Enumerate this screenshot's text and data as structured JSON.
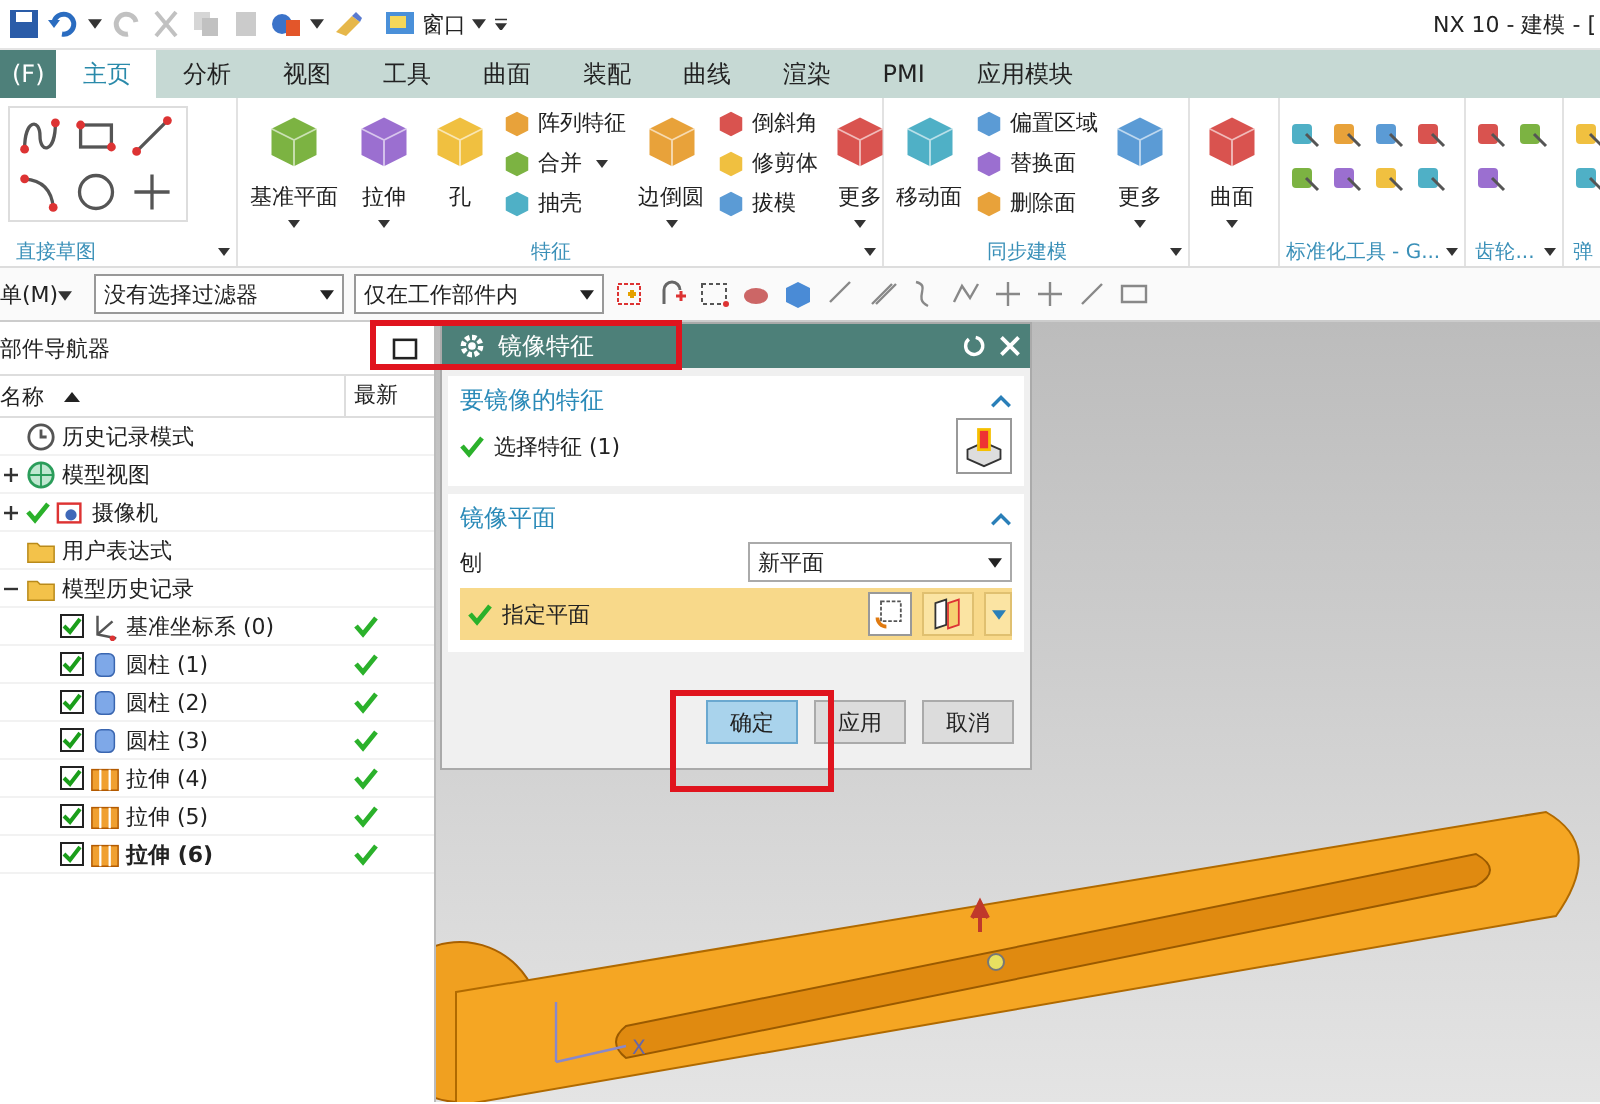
{
  "quick_access": {
    "window_menu": "窗口"
  },
  "window": {
    "title": "NX 10 - 建模 - ["
  },
  "tabs": [
    {
      "label": "(F)",
      "selected": false,
      "kind": "file"
    },
    {
      "label": "主页",
      "selected": true,
      "kind": "tab"
    },
    {
      "label": "分析",
      "selected": false,
      "kind": "tab"
    },
    {
      "label": "视图",
      "selected": false,
      "kind": "tab"
    },
    {
      "label": "工具",
      "selected": false,
      "kind": "tab"
    },
    {
      "label": "曲面",
      "selected": false,
      "kind": "tab"
    },
    {
      "label": "装配",
      "selected": false,
      "kind": "tab"
    },
    {
      "label": "曲线",
      "selected": false,
      "kind": "tab"
    },
    {
      "label": "渲染",
      "selected": false,
      "kind": "tab"
    },
    {
      "label": "PMI",
      "selected": false,
      "kind": "tab"
    },
    {
      "label": "应用模块",
      "selected": false,
      "kind": "tab"
    }
  ],
  "ribbon": [
    {
      "title": "直接草图",
      "kind": "sketch"
    },
    {
      "title": "特征",
      "kind": "buttons",
      "items": [
        {
          "kind": "large",
          "label": "基准平面",
          "menu": true
        },
        {
          "kind": "large",
          "label": "拉伸",
          "menu": true
        },
        {
          "kind": "large",
          "label": "孔",
          "menu": false
        },
        {
          "kind": "stack",
          "items": [
            {
              "label": "阵列特征",
              "menu": false
            },
            {
              "label": "合并",
              "menu": true
            },
            {
              "label": "抽壳",
              "menu": false
            }
          ]
        },
        {
          "kind": "large",
          "label": "边倒圆",
          "menu": true
        },
        {
          "kind": "stack",
          "items": [
            {
              "label": "倒斜角",
              "menu": false
            },
            {
              "label": "修剪体",
              "menu": false
            },
            {
              "label": "拔模",
              "menu": false
            }
          ]
        },
        {
          "kind": "large",
          "label": "更多",
          "menu": true
        }
      ]
    },
    {
      "title": "同步建模",
      "kind": "buttons",
      "items": [
        {
          "kind": "large",
          "label": "移动面",
          "menu": false
        },
        {
          "kind": "stack",
          "items": [
            {
              "label": "偏置区域",
              "menu": false
            },
            {
              "label": "替换面",
              "menu": false
            },
            {
              "label": "删除面",
              "menu": false
            }
          ]
        },
        {
          "kind": "large",
          "label": "更多",
          "menu": true
        }
      ]
    },
    {
      "kind": "buttons",
      "items": [
        {
          "kind": "large",
          "label": "曲面",
          "menu": true
        }
      ]
    },
    {
      "title": "标准化工具 - G...",
      "kind": "grid"
    },
    {
      "title": "齿轮...",
      "kind": "grid"
    },
    {
      "title": "弹",
      "kind": "grid"
    }
  ],
  "selection_bar": {
    "menu_label": "单(M)",
    "filters": [
      "没有选择过滤器",
      "仅在工作部件内"
    ]
  },
  "navigator": {
    "title": "部件导航器",
    "columns": [
      "名称",
      "最新"
    ],
    "tree": [
      {
        "label": "历史记录模式",
        "kind": "clock"
      },
      {
        "label": "模型视图",
        "kind": "view",
        "expanded": false
      },
      {
        "label": "摄像机",
        "kind": "camera",
        "expanded": false,
        "checked": true
      },
      {
        "label": "用户表达式",
        "kind": "folder"
      },
      {
        "label": "模型历史记录",
        "kind": "folder",
        "expanded": true,
        "children": [
          {
            "label": "基准坐标系 (0)",
            "kind": "datum",
            "checked": true,
            "latest": true,
            "current": false
          },
          {
            "label": "圆柱 (1)",
            "kind": "cylinder",
            "checked": true,
            "latest": true,
            "current": false
          },
          {
            "label": "圆柱 (2)",
            "kind": "cylinder",
            "checked": true,
            "latest": true,
            "current": false
          },
          {
            "label": "圆柱 (3)",
            "kind": "cylinder",
            "checked": true,
            "latest": true,
            "current": false
          },
          {
            "label": "拉伸 (4)",
            "kind": "extrude",
            "checked": true,
            "latest": true,
            "current": false
          },
          {
            "label": "拉伸 (5)",
            "kind": "extrude",
            "checked": true,
            "latest": true,
            "current": false
          },
          {
            "label": "拉伸 (6)",
            "kind": "extrude",
            "checked": true,
            "latest": true,
            "current": true
          }
        ]
      }
    ]
  },
  "dialog": {
    "title": "镜像特征",
    "sections": [
      {
        "title": "要镜像的特征",
        "expanded": true,
        "rows": [
          {
            "kind": "select",
            "label": "选择特征 (1)",
            "done": true,
            "active": false
          }
        ]
      },
      {
        "title": "镜像平面",
        "expanded": true,
        "rows": [
          {
            "kind": "dropdown",
            "label": "刨",
            "value": "新平面"
          },
          {
            "kind": "select",
            "label": "指定平面",
            "done": true,
            "active": true
          }
        ]
      }
    ],
    "buttons": [
      {
        "label": "确定",
        "default": true
      },
      {
        "label": "应用",
        "default": false
      },
      {
        "label": "取消",
        "default": false
      }
    ]
  },
  "viewport": {
    "axis_label": "X"
  }
}
